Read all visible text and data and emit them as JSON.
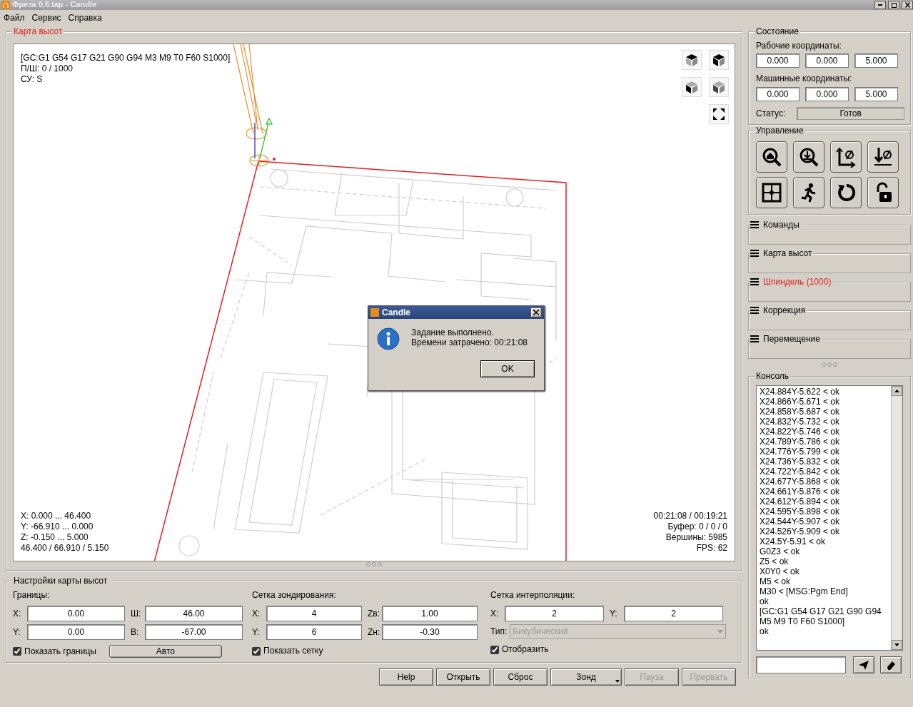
{
  "window": {
    "title": "Фреза 0,6.tap - Candle"
  },
  "menu": [
    "Файл",
    "Сервис",
    "Справка"
  ],
  "heightmap_view": {
    "title": "Карта высот",
    "info_top_left": [
      "[GC:G1 G54 G17 G21 G90 G94 M3 M9 T0 F60 S1000]",
      "П/Ш: 0 / 1000",
      "СУ: S"
    ],
    "info_bottom_left": [
      "X: 0.000 ... 46.400",
      "Y: -66.910 ... 0.000",
      "Z: -0.150 ... 5.000",
      "46.400 / 66.910 / 5.150"
    ],
    "info_bottom_right": [
      "00:21:08 / 00:19:21",
      "Буфер: 0 / 0 / 0",
      "Вершины: 5985",
      "FPS: 62"
    ]
  },
  "dialog": {
    "title": "Candle",
    "message": [
      "Задание выполнено.",
      "Времени затрачено: 00:21:08"
    ],
    "button": "OK"
  },
  "settings": {
    "title": "Настройки карты высот",
    "bounds": {
      "label": "Границы:",
      "fields": [
        {
          "label": "X:",
          "value": "0.00"
        },
        {
          "label": "Ш:",
          "value": "46.00"
        },
        {
          "label": "Y:",
          "value": "0.00"
        },
        {
          "label": "В:",
          "value": "-67.00"
        }
      ],
      "checkbox": {
        "label": "Показать границы",
        "checked": true
      },
      "button": "Авто"
    },
    "probe_grid": {
      "label": "Сетка зондирования:",
      "fields": [
        {
          "label": "X:",
          "value": "4"
        },
        {
          "label": "Zв:",
          "value": "1.00"
        },
        {
          "label": "Y:",
          "value": "6"
        },
        {
          "label": "Zн:",
          "value": "-0.30"
        }
      ],
      "checkbox": {
        "label": "Показать сетку",
        "checked": true
      }
    },
    "interpolation_grid": {
      "label": "Сетка интерполяции:",
      "fields": [
        {
          "label": "X:",
          "value": "2"
        },
        {
          "label": "Y:",
          "value": "2"
        }
      ],
      "type_label": "Тип:",
      "type_value": "Бикубический",
      "type_disabled": true,
      "checkbox": {
        "label": "Отобразить",
        "checked": true
      }
    }
  },
  "buttons": [
    {
      "label": "Help",
      "kind": "plain",
      "disabled": false
    },
    {
      "label": "Открыть",
      "kind": "plain",
      "disabled": false
    },
    {
      "label": "Сброс",
      "kind": "plain",
      "disabled": false
    },
    {
      "label": "Зонд",
      "kind": "menu",
      "disabled": false
    },
    {
      "label": "Пауза",
      "kind": "plain",
      "disabled": true
    },
    {
      "label": "Прервать",
      "kind": "plain",
      "disabled": true
    }
  ],
  "state": {
    "title": "Состояние",
    "work_label": "Рабочие координаты:",
    "work": [
      "0.000",
      "0.000",
      "5.000"
    ],
    "machine_label": "Машинные координаты:",
    "machine": [
      "0.000",
      "0.000",
      "5.000"
    ],
    "status_label": "Статус:",
    "status": "Готов"
  },
  "control": {
    "title": "Управление"
  },
  "panels": [
    {
      "title": "Команды",
      "highlighted": false
    },
    {
      "title": "Карта высот",
      "highlighted": false
    },
    {
      "title": "Шпиндель (1000)",
      "highlighted": true
    },
    {
      "title": "Коррекция",
      "highlighted": false
    },
    {
      "title": "Перемещение",
      "highlighted": false
    }
  ],
  "console": {
    "title": "Консоль",
    "lines": [
      "X24.884Y-5.622 < ok",
      "X24.866Y-5.671 < ok",
      "X24.858Y-5.687 < ok",
      "X24.832Y-5.732 < ok",
      "X24.822Y-5.746 < ok",
      "X24.789Y-5.786 < ok",
      "X24.776Y-5.799 < ok",
      "X24.736Y-5.832 < ok",
      "X24.722Y-5.842 < ok",
      "X24.677Y-5.868 < ok",
      "X24.661Y-5.876 < ok",
      "X24.612Y-5.894 < ok",
      "X24.595Y-5.898 < ok",
      "X24.544Y-5.907 < ok",
      "X24.526Y-5.909 < ok",
      "X24.5Y-5.91 < ok",
      "G0Z3 < ok",
      "Z5 < ok",
      "X0Y0 < ok",
      "M5 < ok",
      "M30 < [MSG:Pgm End]",
      "ok",
      "[GC:G1 G54 G17 G21 G90 G94 M5 M9 T0 F60 S1000]",
      "ok"
    ]
  }
}
